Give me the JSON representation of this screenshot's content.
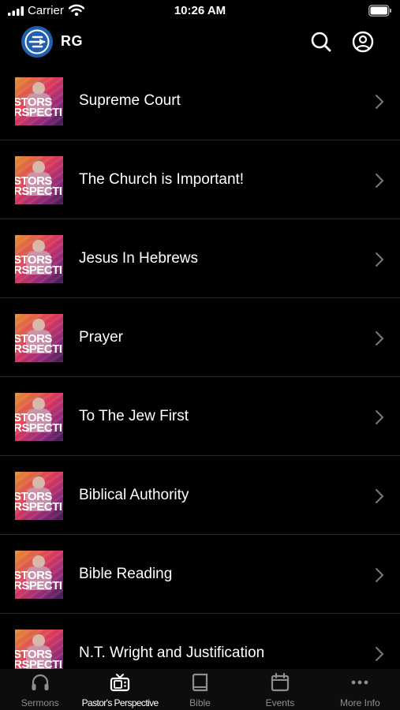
{
  "status_bar": {
    "carrier": "Carrier",
    "time": "10:26 AM"
  },
  "header": {
    "brand": "RG"
  },
  "thumbnail_text": {
    "line1": "STORS",
    "line2": "RSPECTI"
  },
  "items": [
    {
      "title": "Supreme Court"
    },
    {
      "title": "The Church is Important!"
    },
    {
      "title": "Jesus In Hebrews"
    },
    {
      "title": "Prayer"
    },
    {
      "title": "To The Jew First"
    },
    {
      "title": "Biblical Authority"
    },
    {
      "title": "Bible Reading"
    },
    {
      "title": "N.T. Wright and Justification"
    }
  ],
  "tabs": [
    {
      "label": "Sermons",
      "icon": "headphones-icon"
    },
    {
      "label": "Pastor's Perspective",
      "icon": "tv-icon",
      "active": true
    },
    {
      "label": "Bible",
      "icon": "book-icon"
    },
    {
      "label": "Events",
      "icon": "calendar-icon"
    },
    {
      "label": "More Info",
      "icon": "more-icon"
    }
  ],
  "colors": {
    "background": "#000000",
    "active_tab": "#ffffff",
    "inactive_tab": "#8e8e8e",
    "logo_blue": "#1f5fae"
  }
}
